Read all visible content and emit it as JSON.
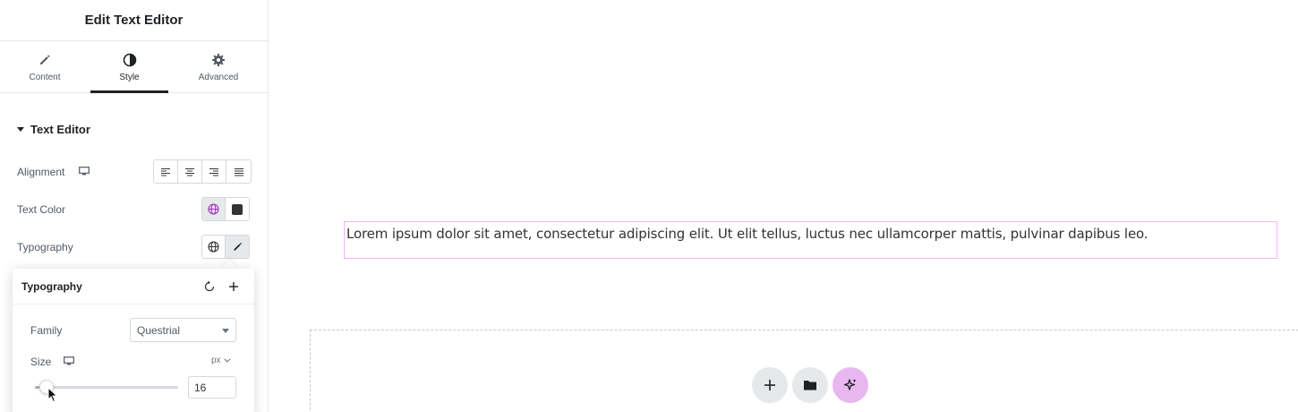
{
  "panel": {
    "title": "Edit Text Editor",
    "tabs": [
      {
        "label": "Content",
        "icon": "pencil-icon"
      },
      {
        "label": "Style",
        "icon": "contrast-icon",
        "active": true
      },
      {
        "label": "Advanced",
        "icon": "gear-icon"
      }
    ],
    "section": {
      "title": "Text Editor",
      "expanded": true
    },
    "controls": {
      "alignment": {
        "label": "Alignment",
        "options": [
          "align-left-icon",
          "align-center-icon",
          "align-right-icon",
          "align-justify-icon"
        ]
      },
      "text_color": {
        "label": "Text Color",
        "swatch_color": "#333333",
        "global_active": true
      },
      "typography": {
        "label": "Typography",
        "edit_active": true
      }
    }
  },
  "typography_popover": {
    "title": "Typography",
    "family": {
      "label": "Family",
      "value": "Questrial"
    },
    "size": {
      "label": "Size",
      "unit": "px",
      "value": "16",
      "slider_fraction": 0.08
    }
  },
  "canvas": {
    "text": "Lorem ipsum dolor sit amet, consectetur adipiscing elit. Ut elit tellus, luctus nec ullamcorper mattis, pulvinar dapibus leo.",
    "selected_border_color": "#e9b7f0",
    "actions": [
      "add-section-icon",
      "template-library-icon",
      "ai-sparkle-icon"
    ]
  },
  "colors": {
    "ai_accent": "#e9b7f0",
    "global_icon": "#a033c0",
    "text_dark": "#1f2124",
    "border": "#d5d8dc"
  }
}
